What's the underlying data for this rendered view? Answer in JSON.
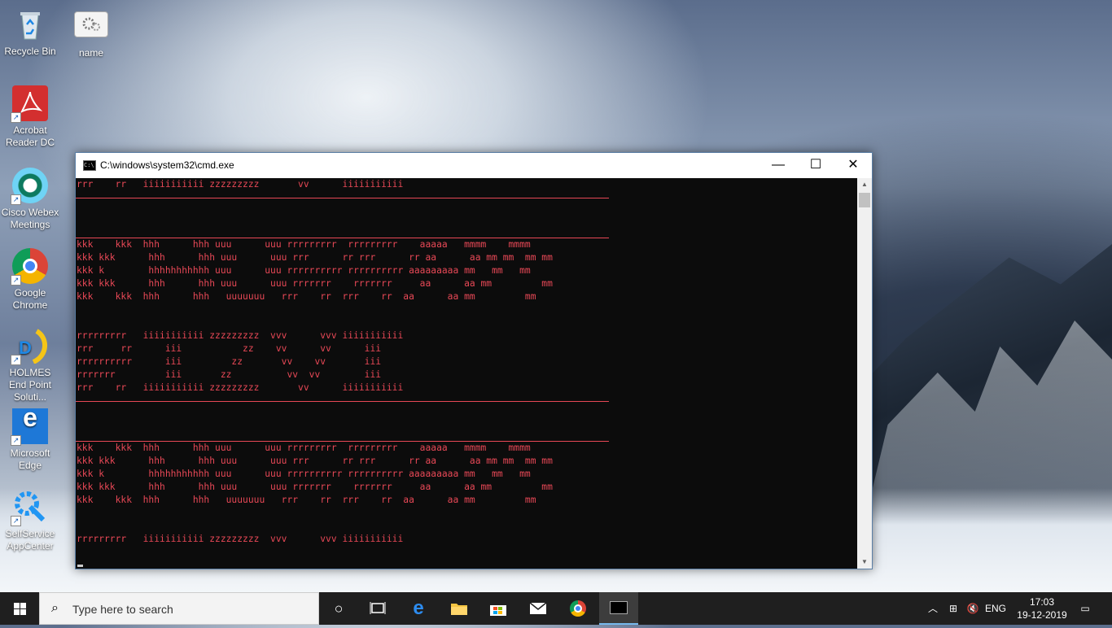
{
  "desktop": {
    "icons": [
      {
        "label": "Recycle Bin"
      },
      {
        "label": "name"
      },
      {
        "label": "Acrobat Reader DC"
      },
      {
        "label": "Cisco Webex Meetings"
      },
      {
        "label": "Google Chrome"
      },
      {
        "label": "HOLMES End Point Soluti..."
      },
      {
        "label": "Microsoft Edge"
      },
      {
        "label": "SelfService AppCenter"
      }
    ]
  },
  "window": {
    "title": "C:\\windows\\system32\\cmd.exe",
    "minimize": "—",
    "maximize": "☐",
    "close": "✕",
    "console_color": "#e74856",
    "blocks": [
      "rrr    rr   iiiiiiiiiii zzzzzzzzz       vv      iiiiiiiiiii",
      "",
      "",
      "",
      "kkk    kkk  hhh      hhh uuu      uuu rrrrrrrrr  rrrrrrrrr    aaaaa   mmmm    mmmm\nkkk kkk      hhh      hhh uuu      uuu rrr      rr rrr      rr aa      aa mm mm  mm mm\nkkk k        hhhhhhhhhhh uuu      uuu rrrrrrrrrr rrrrrrrrrr aaaaaaaaa mm   mm   mm\nkkk kkk      hhh      hhh uuu      uuu rrrrrrr    rrrrrrr     aa      aa mm         mm\nkkk    kkk  hhh      hhh   uuuuuuu   rrr    rr  rrr    rr  aa      aa mm         mm\n\n\nrrrrrrrrr   iiiiiiiiiii zzzzzzzzz  vvv      vvv iiiiiiiiiii\nrrr     rr      iii           zz    vv      vv      iii\nrrrrrrrrrr      iii         zz       vv    vv       iii\nrrrrrrr         iii       zz          vv  vv        iii\nrrr    rr   iiiiiiiiiii zzzzzzzzz       vv      iiiiiiiiiii",
      "",
      "kkk    kkk  hhh      hhh uuu      uuu rrrrrrrrr  rrrrrrrrr    aaaaa   mmmm    mmmm\nkkk kkk      hhh      hhh uuu      uuu rrr      rr rrr      rr aa      aa mm mm  mm mm\nkkk k        hhhhhhhhhhh uuu      uuu rrrrrrrrrr rrrrrrrrrr aaaaaaaaa mm   mm   mm\nkkk kkk      hhh      hhh uuu      uuu rrrrrrr    rrrrrrr     aa      aa mm         mm\nkkk    kkk  hhh      hhh   uuuuuuu   rrr    rr  rrr    rr  aa      aa mm         mm\n\n\nrrrrrrrrr   iiiiiiiiiii zzzzzzzzz  vvv      vvv iiiiiiiiiii"
    ]
  },
  "taskbar": {
    "search_placeholder": "Type here to search",
    "language": "ENG",
    "time": "17:03",
    "date": "19-12-2019",
    "icons": [
      "task-view",
      "edge",
      "file-explorer",
      "store",
      "mail",
      "chrome",
      "cmd"
    ]
  }
}
